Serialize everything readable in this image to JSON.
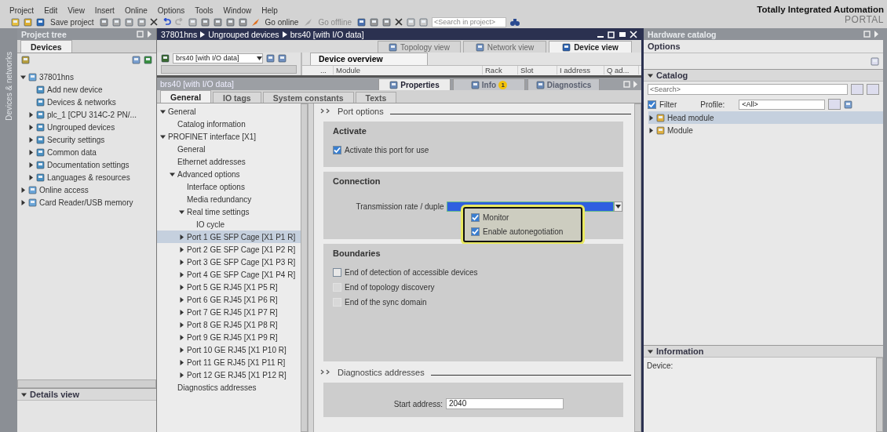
{
  "menu": [
    "Project",
    "Edit",
    "View",
    "Insert",
    "Online",
    "Options",
    "Tools",
    "Window",
    "Help"
  ],
  "toolbar": {
    "save": "Save project",
    "go_online": "Go online",
    "go_offline": "Go offline",
    "search_placeholder": "<Search in project>"
  },
  "brand": {
    "title": "Totally Integrated Automation",
    "subtitle": "PORTAL"
  },
  "side_tab": "Devices & networks",
  "project_tree": {
    "title": "Project tree",
    "tab": "Devices",
    "details_view": "Details view",
    "items": [
      {
        "label": "37801hns",
        "expanded": true,
        "children": [
          {
            "label": "Add new device"
          },
          {
            "label": "Devices & networks"
          },
          {
            "label": "plc_1 [CPU 314C-2 PN/...",
            "expanded": false
          },
          {
            "label": "Ungrouped devices",
            "expanded": false
          },
          {
            "label": "Security settings",
            "expanded": false
          },
          {
            "label": "Common data",
            "expanded": false
          },
          {
            "label": "Documentation settings",
            "expanded": false
          },
          {
            "label": "Languages & resources",
            "expanded": false
          }
        ]
      },
      {
        "label": "Online access",
        "expanded": false
      },
      {
        "label": "Card Reader/USB memory",
        "expanded": false
      }
    ]
  },
  "editor": {
    "breadcrumb": [
      "37801hns",
      "Ungrouped devices",
      "brs40 [with I/O data]"
    ],
    "view_tabs": [
      {
        "label": "Topology view",
        "selected": false
      },
      {
        "label": "Network view",
        "selected": false
      },
      {
        "label": "Device view",
        "selected": true
      }
    ],
    "device_select": "brs40 [with I/O data]",
    "overview_tab": "Device overview",
    "columns": [
      "...",
      "Module",
      "Rack",
      "Slot",
      "I address",
      "Q ad..."
    ]
  },
  "properties": {
    "title": "brs40 [with I/O data]",
    "panel_tabs": [
      {
        "label": "Properties",
        "selected": true
      },
      {
        "label": "Info",
        "selected": false,
        "badge": "1"
      },
      {
        "label": "Diagnostics",
        "selected": false
      }
    ],
    "tabs": [
      {
        "label": "General",
        "selected": true
      },
      {
        "label": "IO tags",
        "selected": false
      },
      {
        "label": "System constants",
        "selected": false
      },
      {
        "label": "Texts",
        "selected": false
      }
    ],
    "nav": [
      {
        "label": "General",
        "expanded": true,
        "selected": false,
        "children": [
          {
            "label": "Catalog information",
            "selected": false
          }
        ]
      },
      {
        "label": "PROFINET interface [X1]",
        "expanded": true,
        "selected": false,
        "children": [
          {
            "label": "General",
            "selected": false
          },
          {
            "label": "Ethernet addresses",
            "selected": false
          },
          {
            "label": "Advanced options",
            "expanded": true,
            "selected": false,
            "children": [
              {
                "label": "Interface options",
                "selected": false
              },
              {
                "label": "Media redundancy",
                "selected": false
              },
              {
                "label": "Real time settings",
                "expanded": true,
                "selected": false,
                "children": [
                  {
                    "label": "IO cycle",
                    "selected": false
                  }
                ]
              },
              {
                "label": "Port 1 GE SFP Cage [X1 P1 R]",
                "expanded": false,
                "selected": true
              },
              {
                "label": "Port 2 GE SFP Cage [X1 P2 R]",
                "expanded": false,
                "selected": false
              },
              {
                "label": "Port 3 GE SFP Cage [X1 P3 R]",
                "expanded": false,
                "selected": false
              },
              {
                "label": "Port 4 GE SFP Cage [X1 P4 R]",
                "expanded": false,
                "selected": false
              },
              {
                "label": "Port 5 GE RJ45 [X1 P5 R]",
                "expanded": false,
                "selected": false
              },
              {
                "label": "Port 6 GE RJ45 [X1 P6 R]",
                "expanded": false,
                "selected": false
              },
              {
                "label": "Port 7 GE RJ45 [X1 P7 R]",
                "expanded": false,
                "selected": false
              },
              {
                "label": "Port 8 GE RJ45 [X1 P8 R]",
                "expanded": false,
                "selected": false
              },
              {
                "label": "Port 9 GE RJ45 [X1 P9 R]",
                "expanded": false,
                "selected": false
              },
              {
                "label": "Port 10 GE RJ45 [X1 P10 R]",
                "expanded": false,
                "selected": false
              },
              {
                "label": "Port 11 GE RJ45 [X1 P11 R]",
                "expanded": false,
                "selected": false
              },
              {
                "label": "Port 12 GE RJ45 [X1 P12 R]",
                "expanded": false,
                "selected": false
              }
            ]
          },
          {
            "label": "Diagnostics addresses",
            "selected": false
          }
        ]
      }
    ],
    "sections": [
      {
        "kind": "heading",
        "title": "Port options"
      },
      {
        "kind": "group",
        "title": "Activate",
        "checks": [
          {
            "label": "Activate this port for use",
            "checked": true,
            "disabled": false
          }
        ]
      },
      {
        "kind": "connection",
        "title": "Connection",
        "field_label": "Transmission rate / duple",
        "popup_checks": [
          {
            "label": "Monitor",
            "checked": true
          },
          {
            "label": "Enable autonegotiation",
            "checked": true
          }
        ]
      },
      {
        "kind": "group",
        "title": "Boundaries",
        "checks": [
          {
            "label": "End of detection of accessible devices",
            "checked": false,
            "disabled": false
          },
          {
            "label": "End of topology discovery",
            "checked": false,
            "disabled": true
          },
          {
            "label": "End of the sync domain",
            "checked": false,
            "disabled": true
          }
        ]
      },
      {
        "kind": "heading",
        "title": "Diagnostics addresses"
      },
      {
        "kind": "address",
        "field_label": "Start address:",
        "value": "2040"
      }
    ]
  },
  "catalog": {
    "title": "Hardware catalog",
    "options": "Options",
    "section": "Catalog",
    "section_expanded": true,
    "search_placeholder": "<Search>",
    "filter": {
      "label": "Filter",
      "checked": true
    },
    "profile_label": "Profile:",
    "profile_value": "<All>",
    "items": [
      {
        "label": "Head module",
        "selected": true
      },
      {
        "label": "Module",
        "selected": false
      }
    ],
    "info_title": "Information",
    "info_expanded": true,
    "info_label": "Device:"
  }
}
